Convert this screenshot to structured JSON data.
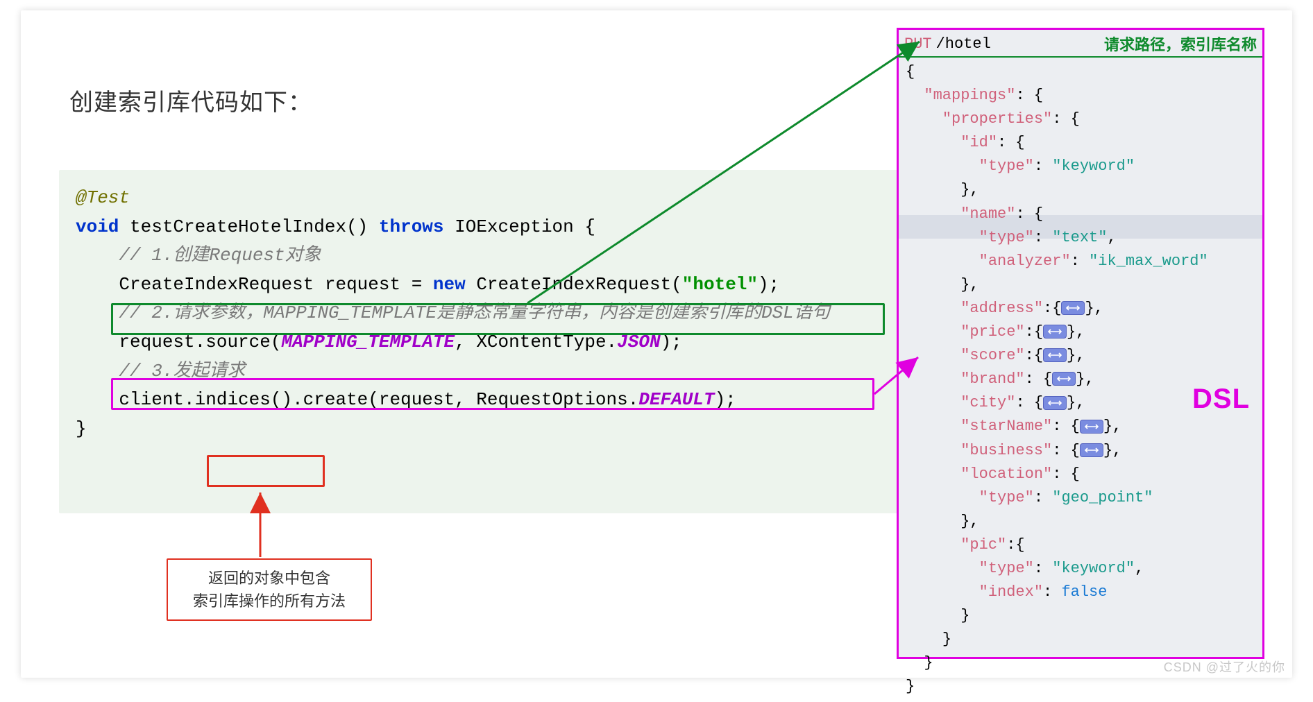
{
  "title": "创建索引库代码如下：",
  "code": {
    "ann": "@Test",
    "void": "void",
    "fn": " testCreateHotelIndex() ",
    "throws": "throws",
    "exc": " IOException {",
    "c1": "// 1.创建Request对象",
    "l1a": "CreateIndexRequest request = ",
    "new": "new",
    "l1b": " CreateIndexRequest(",
    "str": "\"hotel\"",
    "l1c": ");",
    "c2": "// 2.请求参数，MAPPING_TEMPLATE是静态常量字符串，内容是创建索引库的DSL语句",
    "l2a": "request.source(",
    "mt": "MAPPING_TEMPLATE",
    "l2b": ", XContentType.",
    "json": "JSON",
    "l2c": ");",
    "c3": "// 3.发起请求",
    "l3a": "client.indices().create(request, RequestOptions.",
    "def": "DEFAULT",
    "l3b": ");",
    "close": "}"
  },
  "callout": {
    "line1": "返回的对象中包含",
    "line2": "索引库操作的所有方法"
  },
  "dsl": {
    "method": "PUT",
    "path": "/hotel",
    "note": "请求路径，索引库名称",
    "label": "DSL"
  },
  "json": {
    "mappings": "\"mappings\"",
    "properties": "\"properties\"",
    "id": "\"id\"",
    "type": "\"type\"",
    "keyword": "\"keyword\"",
    "name": "\"name\"",
    "text": "\"text\"",
    "analyzer": "\"analyzer\"",
    "ik": "\"ik_max_word\"",
    "address": "\"address\"",
    "price": "\"price\"",
    "score": "\"score\"",
    "brand": "\"brand\"",
    "city": "\"city\"",
    "starName": "\"starName\"",
    "business": "\"business\"",
    "location": "\"location\"",
    "geo": "\"geo_point\"",
    "pic": "\"pic\"",
    "index": "\"index\"",
    "false": "false"
  },
  "watermark": "CSDN @过了火的你"
}
